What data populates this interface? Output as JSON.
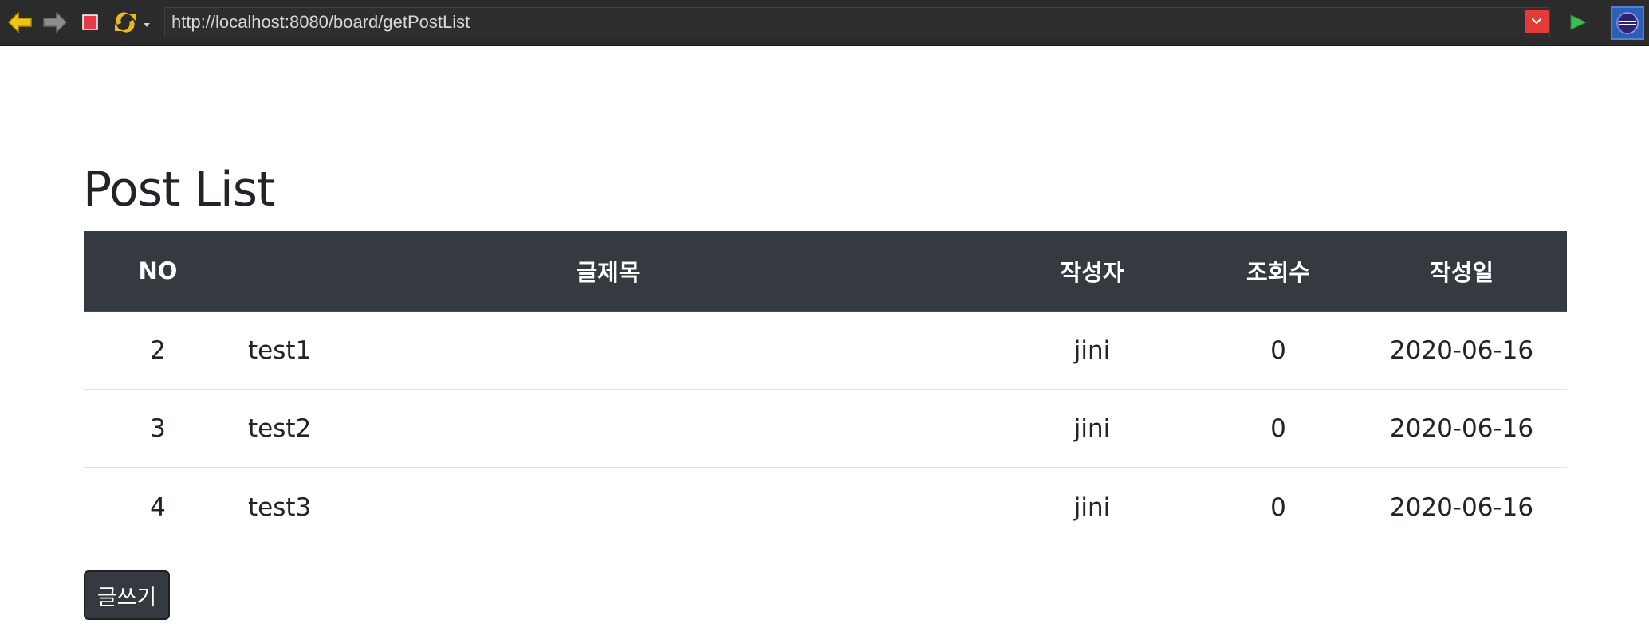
{
  "browser": {
    "url": "http://localhost:8080/board/getPostList",
    "icons": {
      "back": "back-arrow-icon",
      "forward": "forward-arrow-icon",
      "stop": "stop-icon",
      "refresh": "refresh-icon",
      "url_dropdown": "chevron-down-icon",
      "go": "play-icon",
      "eclipse": "eclipse-icon"
    }
  },
  "page": {
    "title": "Post List",
    "table": {
      "headers": [
        "NO",
        "글제목",
        "작성자",
        "조회수",
        "작성일"
      ],
      "rows": [
        {
          "no": "2",
          "title": "test1",
          "writer": "jini",
          "views": "0",
          "date": "2020-06-16"
        },
        {
          "no": "3",
          "title": "test2",
          "writer": "jini",
          "views": "0",
          "date": "2020-06-16"
        },
        {
          "no": "4",
          "title": "test3",
          "writer": "jini",
          "views": "0",
          "date": "2020-06-16"
        }
      ]
    },
    "write_button_label": "글쓰기"
  },
  "colors": {
    "table_header_bg": "#343a40",
    "button_bg": "#343a40",
    "text": "#212529",
    "toolbar_bg": "#2b2b2b"
  }
}
